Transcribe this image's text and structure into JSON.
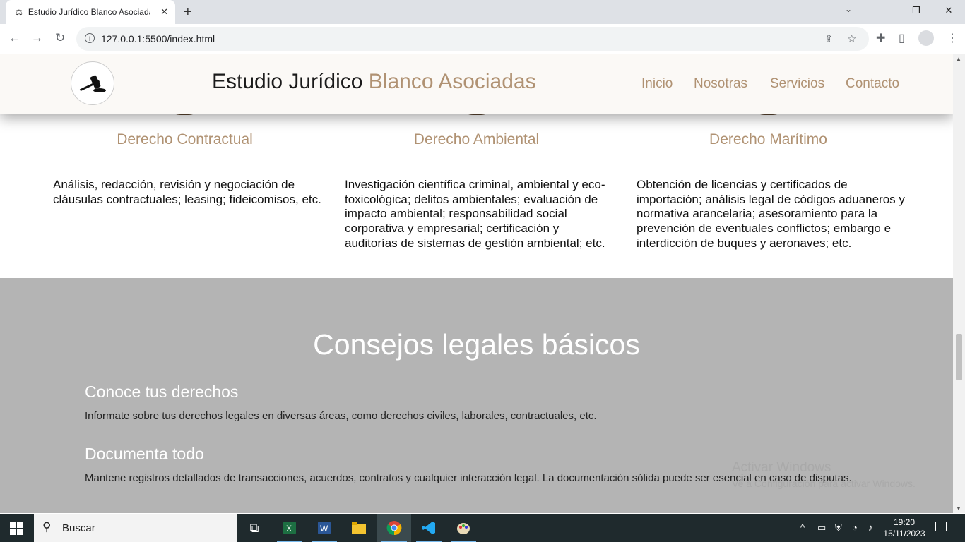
{
  "browser": {
    "tab_title": "Estudio Jurídico Blanco Asociadas",
    "url": "127.0.0.1:5500/index.html"
  },
  "site": {
    "brand_main": "Estudio Jurídico ",
    "brand_accent": "Blanco Asociadas",
    "nav": [
      "Inicio",
      "Nosotras",
      "Servicios",
      "Contacto"
    ]
  },
  "services": [
    {
      "title": "Derecho Contractual",
      "description": "Análisis, redacción, revisión y negociación de cláusulas contractuales; leasing; fideicomisos, etc."
    },
    {
      "title": "Derecho Ambiental",
      "description": "Investigación científica criminal, ambiental y eco-toxicológica; delitos ambientales; evaluación de impacto ambiental; responsabilidad social corporativa y empresarial; certificación y auditorías de sistemas de gestión ambiental; etc."
    },
    {
      "title": "Derecho Marítimo",
      "description": "Obtención de licencias y certificados de importación; análisis legal de códigos aduaneros y normativa arancelaria; asesoramiento para la prevención de eventuales conflictos; embargo e interdicción de buques y aeronaves; etc."
    }
  ],
  "tips": {
    "title": "Consejos legales básicos",
    "items": [
      {
        "heading": "Conoce tus derechos",
        "body": "Informate sobre tus derechos legales en diversas áreas, como derechos civiles, laborales, contractuales, etc."
      },
      {
        "heading": "Documenta todo",
        "body": "Mantene registros detallados de transacciones, acuerdos, contratos y cualquier interacción legal. La documentación sólida puede ser esencial en caso de disputas."
      }
    ]
  },
  "watermark": {
    "line1": "Activar Windows",
    "line2": "Ve a Configuración para activar Windows."
  },
  "taskbar": {
    "search_placeholder": "Buscar",
    "time": "19:20",
    "date": "15/11/2023"
  },
  "colors": {
    "accent": "#b09273",
    "tips_background": "#b4b4b4",
    "header_background": "#fbf9f6"
  }
}
